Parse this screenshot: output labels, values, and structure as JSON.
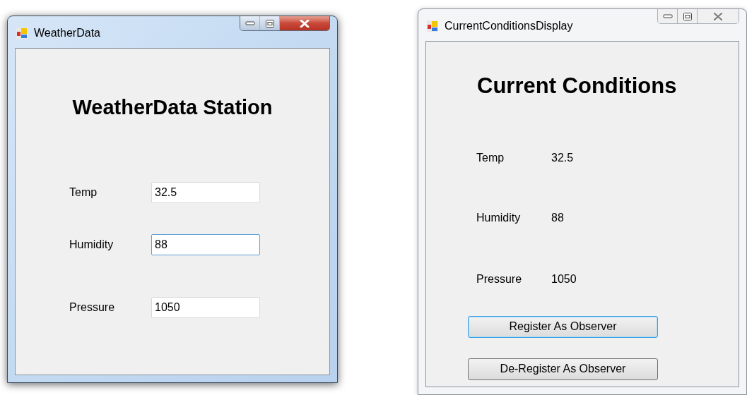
{
  "windows": [
    {
      "kind": "input",
      "title": "WeatherData",
      "active": true,
      "heading": "WeatherData Station",
      "fields": [
        {
          "label": "Temp",
          "value": "32.5",
          "focused": false
        },
        {
          "label": "Humidity",
          "value": "88",
          "focused": true
        },
        {
          "label": "Pressure",
          "value": "1050",
          "focused": false
        }
      ]
    },
    {
      "kind": "display",
      "title": "CurrentConditionsDisplay",
      "active": false,
      "heading": "Current Conditions",
      "readings": [
        {
          "label": "Temp",
          "value": "32.5"
        },
        {
          "label": "Humidity",
          "value": "88"
        },
        {
          "label": "Pressure",
          "value": "1050"
        }
      ],
      "buttons": [
        {
          "label": "Register As Observer",
          "focused": true
        },
        {
          "label": "De-Register As Observer",
          "focused": false
        }
      ]
    }
  ]
}
